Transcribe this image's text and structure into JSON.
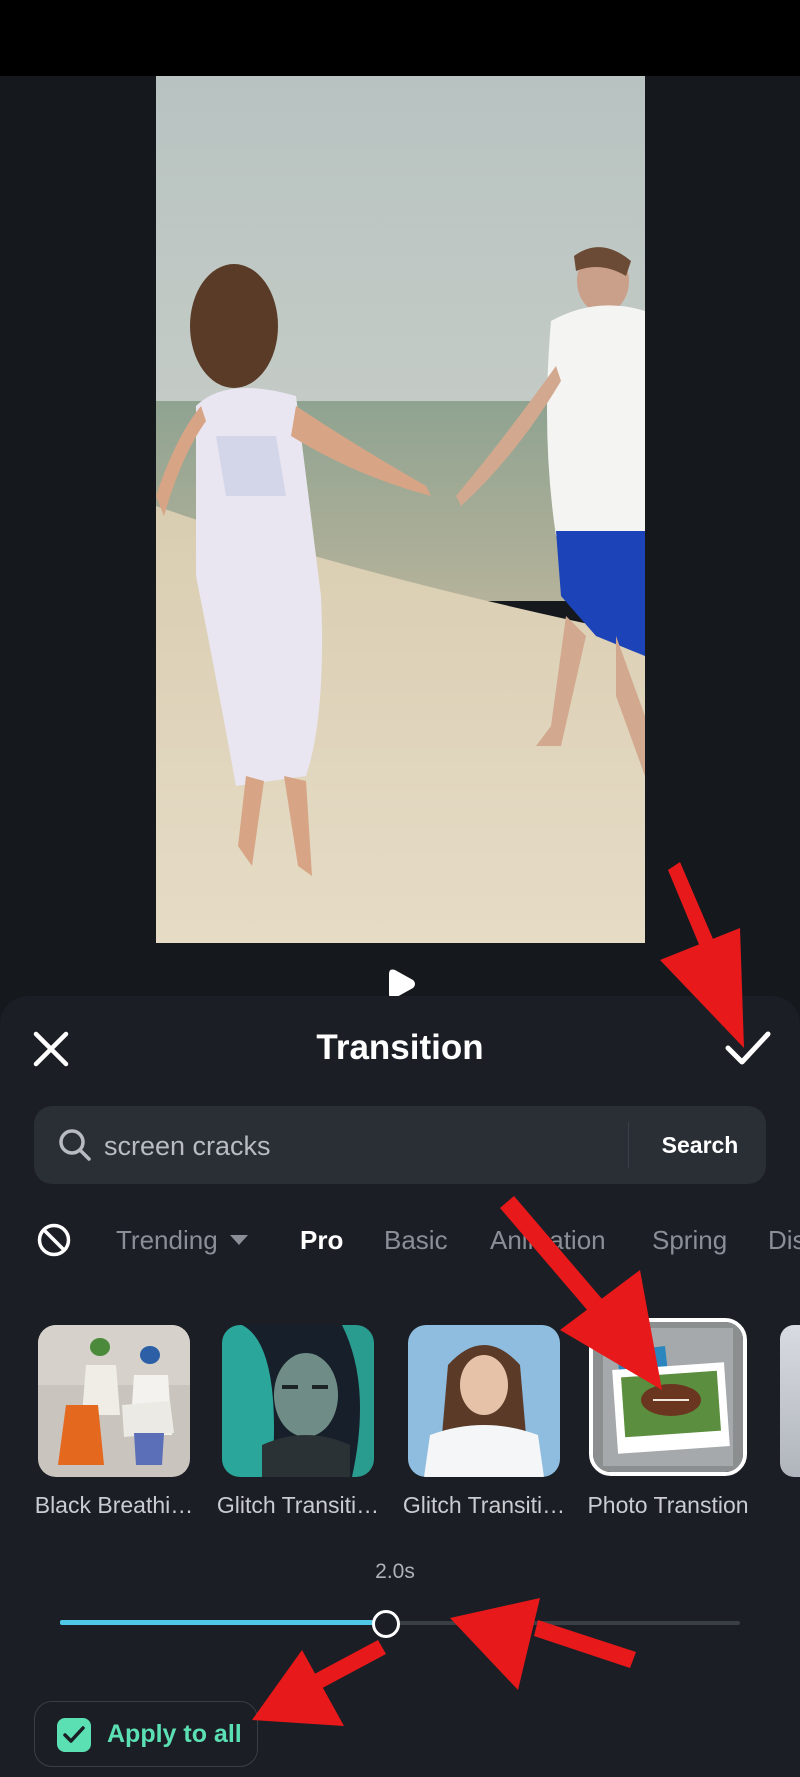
{
  "sheet": {
    "title": "Transition"
  },
  "search": {
    "value": "screen cracks",
    "button_label": "Search"
  },
  "categories": [
    "Trending",
    "Pro",
    "Basic",
    "Animation",
    "Spring",
    "Dis"
  ],
  "active_category": "Pro",
  "transitions": [
    {
      "label": "Black Breathi…"
    },
    {
      "label": "Glitch Transiti…"
    },
    {
      "label": "Glitch Transiti…"
    },
    {
      "label": "Photo Transtion",
      "selected": true
    }
  ],
  "duration": {
    "label": "2.0s",
    "fraction": 0.48
  },
  "apply_all": {
    "label": "Apply to all",
    "checked": true
  },
  "colors": {
    "accent": "#4ec8e6",
    "check_green": "#5be0b4",
    "annotation_red": "#e8191a"
  },
  "icons": {
    "close": "close-icon",
    "confirm": "checkmark-icon",
    "search": "search-icon",
    "none": "no-transition-icon",
    "caret": "caret-down-icon",
    "play": "play-icon"
  }
}
